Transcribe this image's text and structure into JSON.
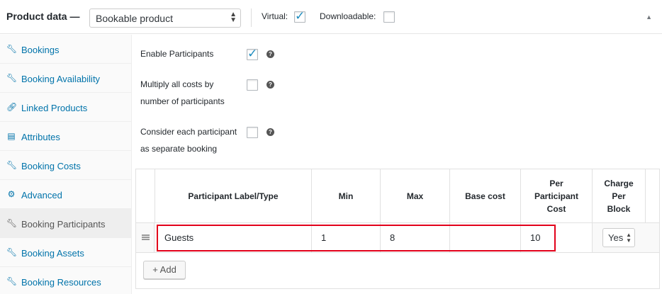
{
  "header": {
    "title": "Product data —",
    "product_type": "Bookable product",
    "virtual_label": "Virtual:",
    "virtual_checked": true,
    "downloadable_label": "Downloadable:",
    "downloadable_checked": false
  },
  "sidebar": {
    "items": [
      {
        "label": "Bookings",
        "icon": "wrench-icon"
      },
      {
        "label": "Booking Availability",
        "icon": "wrench-icon"
      },
      {
        "label": "Linked Products",
        "icon": "link-icon"
      },
      {
        "label": "Attributes",
        "icon": "list-icon"
      },
      {
        "label": "Booking Costs",
        "icon": "wrench-icon"
      },
      {
        "label": "Advanced",
        "icon": "gear-icon"
      },
      {
        "label": "Booking Participants",
        "icon": "wrench-icon",
        "active": true
      },
      {
        "label": "Booking Assets",
        "icon": "wrench-icon"
      },
      {
        "label": "Booking Resources",
        "icon": "wrench-icon"
      }
    ]
  },
  "fields": {
    "enable_participants": {
      "label": "Enable Participants",
      "checked": true
    },
    "multiply_costs": {
      "label_line1": "Multiply all costs by",
      "label_line2": "number of participants",
      "checked": false
    },
    "separate_booking": {
      "label_line1": "Consider each participant",
      "label_line2": "as separate booking",
      "checked": false
    }
  },
  "table": {
    "headers": {
      "label": "Participant Label/Type",
      "min": "Min",
      "max": "Max",
      "base_cost": "Base cost",
      "per_participant_line1": "Per",
      "per_participant_line2": "Participant",
      "per_participant_line3": "Cost",
      "charge_line1": "Charge",
      "charge_line2": "Per",
      "charge_line3": "Block"
    },
    "rows": [
      {
        "label": "Guests",
        "min": "1",
        "max": "8",
        "base_cost": "",
        "per_participant_cost": "10",
        "charge_per_block": "Yes"
      }
    ],
    "add_button": "+ Add"
  },
  "colors": {
    "link": "#0073aa",
    "checkmark": "#1e8cbe",
    "highlight": "#e2001a"
  }
}
